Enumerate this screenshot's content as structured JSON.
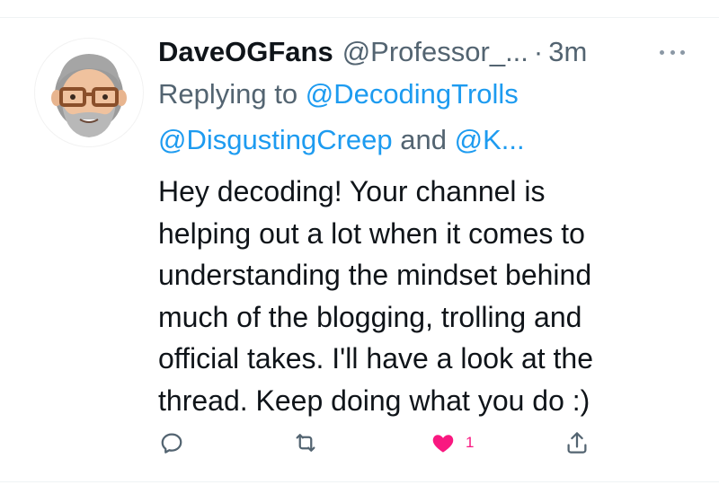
{
  "tweet": {
    "display_name": "DaveOGFans",
    "handle": "@Professor_...",
    "separator": "·",
    "time": "3m",
    "replying_prefix": "Replying to",
    "replying_to_1": "@DecodingTrolls",
    "replying_to_2": "@DisgustingCreep",
    "replying_and": "and",
    "replying_to_more": "@K...",
    "text_lines": [
      "Hey decoding! Your channel is",
      "helping out a lot when it comes to",
      "understanding the mindset behind",
      "much of the blogging, trolling and",
      "official takes. I'll have a look at the",
      "thread. Keep doing what you do :)"
    ],
    "like_count": "1"
  },
  "icons": {
    "more": "more-horizontal-icon",
    "reply": "reply-icon",
    "retweet": "retweet-icon",
    "like": "heart-filled-icon",
    "share": "share-icon"
  },
  "colors": {
    "link": "#1d9bf0",
    "muted": "#536471",
    "text": "#0f1419",
    "like": "#f91880"
  }
}
